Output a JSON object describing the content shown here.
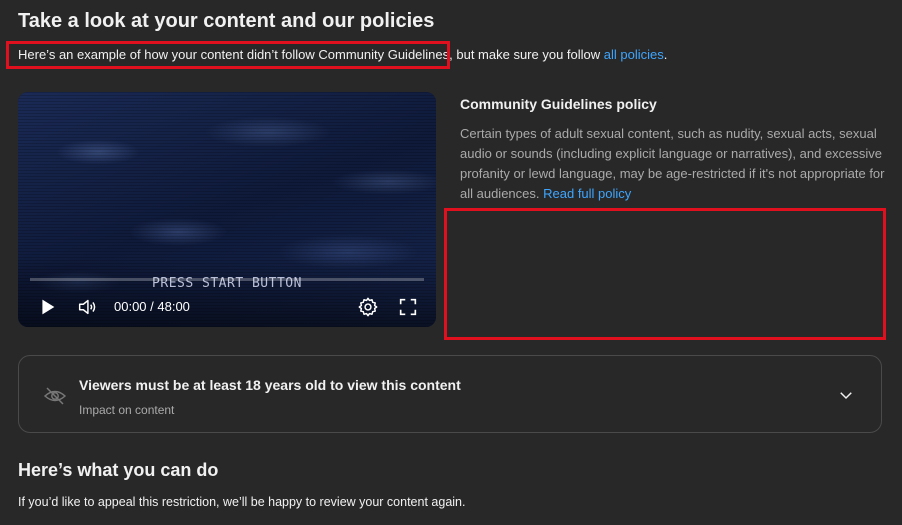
{
  "header": {
    "title": "Take a look at your content and our policies",
    "intro_text": "Here’s an example of how your content didn’t follow Community Guidelines, but make sure you follow ",
    "intro_link": "all policies",
    "intro_end": "."
  },
  "player": {
    "overlay_text": "PRESS START BUTTON",
    "time": "00:00 / 48:00",
    "icons": [
      "play-icon",
      "volume-icon",
      "settings-gear-icon",
      "fullscreen-icon"
    ]
  },
  "policy": {
    "title": "Community Guidelines policy",
    "body": "Certain types of adult sexual content, such as nudity, sexual acts, sexual audio or sounds (including explicit language or narratives), and excessive profanity or lewd language, may be age-restricted if it's not appropriate for all audiences. ",
    "link": "Read full policy"
  },
  "restriction_card": {
    "title": "Viewers must be at least 18 years old to view this content",
    "subtitle": "Impact on content",
    "icon": "eye-off-icon",
    "expand_icon": "chevron-down-icon"
  },
  "actions": {
    "heading": "Here’s what you can do",
    "appeal_text": "If you’d like to appeal this restriction, we’ll be happy to review your content again."
  },
  "colors": {
    "background": "#282828",
    "link": "#3ea6ff",
    "highlight_box": "#e0101e"
  }
}
